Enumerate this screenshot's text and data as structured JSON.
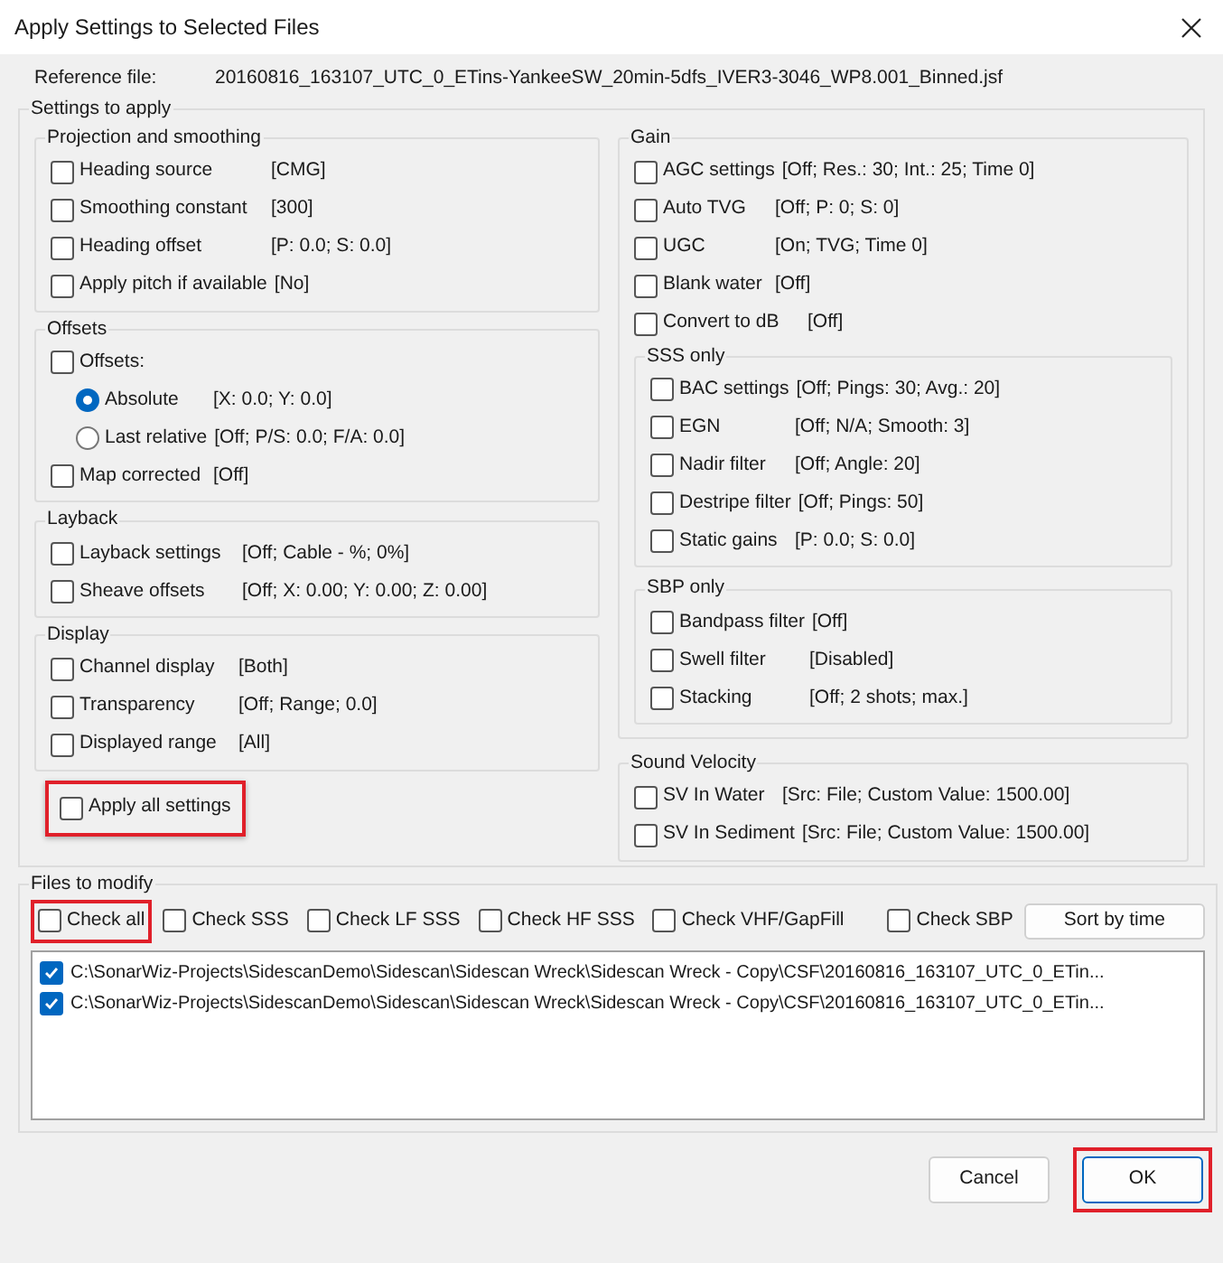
{
  "window": {
    "title": "Apply Settings to Selected Files"
  },
  "reference": {
    "label": "Reference file:",
    "value": "20160816_163107_UTC_0_ETins-YankeeSW_20min-5dfs_IVER3-3046_WP8.001_Binned.jsf"
  },
  "settings": {
    "title": "Settings to apply",
    "left_groups": [
      {
        "title": "Projection and smoothing",
        "items": [
          {
            "kind": "checkbox",
            "label": "Heading source",
            "value": "[CMG]",
            "checked": false
          },
          {
            "kind": "checkbox",
            "label": "Smoothing constant",
            "value": "[300]",
            "checked": false
          },
          {
            "kind": "checkbox",
            "label": "Heading offset",
            "value": "[P: 0.0; S: 0.0]",
            "checked": false
          },
          {
            "kind": "checkbox",
            "label": "Apply pitch if available",
            "value": "[No]",
            "checked": false
          }
        ]
      },
      {
        "title": "Offsets",
        "items": [
          {
            "kind": "checkbox",
            "label": "Offsets:",
            "checked": false
          },
          {
            "kind": "radio",
            "label": "Absolute",
            "value": "[X: 0.0; Y: 0.0]",
            "selected": true
          },
          {
            "kind": "radio",
            "label": "Last relative",
            "value": "[Off; P/S: 0.0; F/A: 0.0]",
            "selected": false
          },
          {
            "kind": "checkbox",
            "label": "Map corrected",
            "value": "[Off]",
            "checked": false
          }
        ]
      },
      {
        "title": "Layback",
        "items": [
          {
            "kind": "checkbox",
            "label": "Layback settings",
            "value": "[Off; Cable - %; 0%]",
            "checked": false
          },
          {
            "kind": "checkbox",
            "label": "Sheave offsets",
            "value": "[Off; X: 0.00; Y: 0.00; Z: 0.00]",
            "checked": false
          }
        ]
      },
      {
        "title": "Display",
        "items": [
          {
            "kind": "checkbox",
            "label": "Channel display",
            "value": "[Both]",
            "checked": false
          },
          {
            "kind": "checkbox",
            "label": "Transparency",
            "value": "[Off; Range; 0.0]",
            "checked": false
          },
          {
            "kind": "checkbox",
            "label": "Displayed range",
            "value": "[All]",
            "checked": false
          }
        ]
      }
    ],
    "apply_all": {
      "label": "Apply all settings",
      "checked": false,
      "highlighted": true
    },
    "gain": {
      "title": "Gain",
      "items": [
        {
          "kind": "checkbox",
          "label": "AGC settings",
          "value": "[Off; Res.: 30; Int.: 25; Time 0]",
          "checked": false
        },
        {
          "kind": "checkbox",
          "label": "Auto TVG",
          "value": "[Off; P: 0; S: 0]",
          "checked": false
        },
        {
          "kind": "checkbox",
          "label": "UGC",
          "value": "[On; TVG; Time 0]",
          "checked": false
        },
        {
          "kind": "checkbox",
          "label": "Blank water",
          "value": "[Off]",
          "checked": false
        },
        {
          "kind": "checkbox",
          "label": "Convert to dB",
          "value": "[Off]",
          "checked": false
        }
      ],
      "subgroups": [
        {
          "title": "SSS only",
          "items": [
            {
              "kind": "checkbox",
              "label": "BAC settings",
              "value": "[Off; Pings: 30; Avg.: 20]",
              "checked": false
            },
            {
              "kind": "checkbox",
              "label": "EGN",
              "value": "[Off; N/A; Smooth: 3]",
              "checked": false
            },
            {
              "kind": "checkbox",
              "label": "Nadir filter",
              "value": "[Off; Angle: 20]",
              "checked": false
            },
            {
              "kind": "checkbox",
              "label": "Destripe filter",
              "value": "[Off; Pings: 50]",
              "checked": false
            },
            {
              "kind": "checkbox",
              "label": "Static gains",
              "value": "[P: 0.0; S: 0.0]",
              "checked": false
            }
          ]
        },
        {
          "title": "SBP only",
          "items": [
            {
              "kind": "checkbox",
              "label": "Bandpass filter",
              "value": "[Off]",
              "checked": false
            },
            {
              "kind": "checkbox",
              "label": "Swell filter",
              "value": "[Disabled]",
              "checked": false
            },
            {
              "kind": "checkbox",
              "label": "Stacking",
              "value": "[Off; 2 shots; max.]",
              "checked": false
            }
          ]
        }
      ]
    },
    "sound_velocity": {
      "title": "Sound Velocity",
      "items": [
        {
          "kind": "checkbox",
          "label": "SV In Water",
          "value": "[Src: File; Custom Value: 1500.00]",
          "checked": false
        },
        {
          "kind": "checkbox",
          "label": "SV In Sediment",
          "value": "[Src: File; Custom Value: 1500.00]",
          "checked": false
        }
      ]
    }
  },
  "files": {
    "title": "Files to modify",
    "filters": [
      {
        "label": "Check all",
        "checked": false,
        "highlighted": true
      },
      {
        "label": "Check SSS",
        "checked": false,
        "highlighted": false
      },
      {
        "label": "Check LF SSS",
        "checked": false,
        "highlighted": false
      },
      {
        "label": "Check HF SSS",
        "checked": false,
        "highlighted": false
      },
      {
        "label": "Check VHF/GapFill",
        "checked": false,
        "highlighted": false
      },
      {
        "label": "Check SBP",
        "checked": false,
        "highlighted": false
      }
    ],
    "sort_button": "Sort by time",
    "list": [
      {
        "path": "C:\\SonarWiz-Projects\\SidescanDemo\\Sidescan\\Sidescan Wreck\\Sidescan Wreck - Copy\\CSF\\20160816_163107_UTC_0_ETin...",
        "checked": true
      },
      {
        "path": "C:\\SonarWiz-Projects\\SidescanDemo\\Sidescan\\Sidescan Wreck\\Sidescan Wreck - Copy\\CSF\\20160816_163107_UTC_0_ETin...",
        "checked": true
      }
    ]
  },
  "buttons": [
    {
      "label": "Cancel",
      "highlighted": false,
      "default": false
    },
    {
      "label": "OK",
      "highlighted": true,
      "default": true
    }
  ]
}
